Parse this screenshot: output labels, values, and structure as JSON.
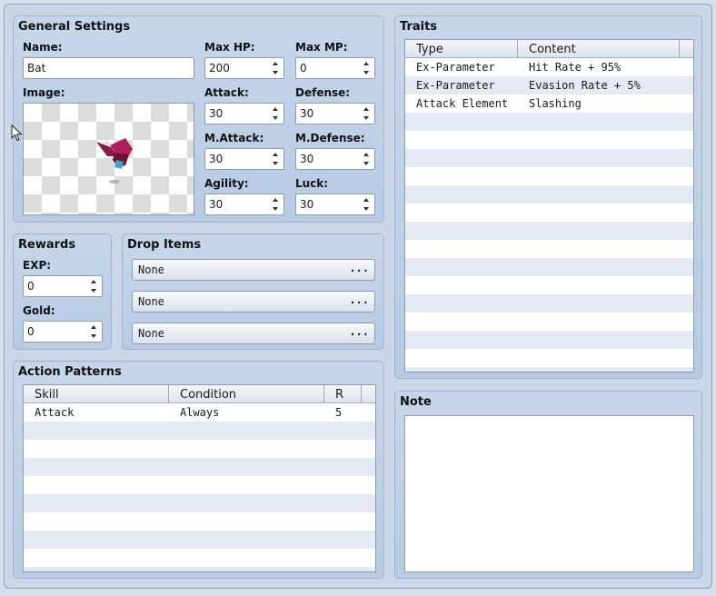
{
  "general": {
    "title": "General Settings",
    "name_label": "Name:",
    "name_value": "Bat",
    "image_label": "Image:",
    "max_hp_label": "Max HP:",
    "max_hp": "200",
    "max_mp_label": "Max MP:",
    "max_mp": "0",
    "attack_label": "Attack:",
    "attack": "30",
    "defense_label": "Defense:",
    "defense": "30",
    "mattack_label": "M.Attack:",
    "mattack": "30",
    "mdefense_label": "M.Defense:",
    "mdefense": "30",
    "agility_label": "Agility:",
    "agility": "30",
    "luck_label": "Luck:",
    "luck": "30"
  },
  "rewards": {
    "title": "Rewards",
    "exp_label": "EXP:",
    "exp": "0",
    "gold_label": "Gold:",
    "gold": "0"
  },
  "drops": {
    "title": "Drop Items",
    "items": [
      "None",
      "None",
      "None"
    ],
    "more_label": "..."
  },
  "actions": {
    "title": "Action Patterns",
    "headers": [
      "Skill",
      "Condition",
      "R"
    ],
    "rows": [
      {
        "skill": "Attack",
        "condition": "Always",
        "r": "5"
      }
    ]
  },
  "traits": {
    "title": "Traits",
    "headers": [
      "Type",
      "Content"
    ],
    "rows": [
      {
        "type": "Ex-Parameter",
        "content": "Hit Rate + 95%"
      },
      {
        "type": "Ex-Parameter",
        "content": "Evasion Rate + 5%"
      },
      {
        "type": "Attack Element",
        "content": "Slashing"
      }
    ]
  },
  "note": {
    "title": "Note",
    "value": ""
  },
  "icons": {
    "spin": "up-down-arrows-icon",
    "cursor": "mouse-pointer-icon",
    "sprite": "bat-sprite-icon"
  }
}
